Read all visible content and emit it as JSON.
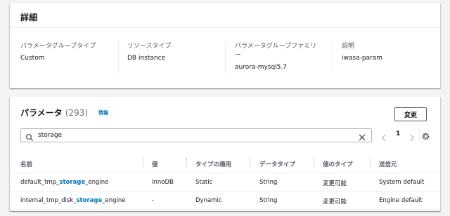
{
  "details": {
    "title": "詳細",
    "items": [
      {
        "label": "パラメータグループタイプ",
        "value": "Custom"
      },
      {
        "label": "リソースタイプ",
        "value": "DB instance"
      },
      {
        "label": "パラメータグループファミリ",
        "label_cont": "ー",
        "value": "aurora-mysql5.7"
      },
      {
        "label": "説明",
        "value": "iwasa-param"
      }
    ]
  },
  "parameters": {
    "title": "パラメータ",
    "count": "(293)",
    "info_link": "情報",
    "edit_button": "変更",
    "search": {
      "value": "storage"
    },
    "pagination": {
      "current_page": "1"
    },
    "columns": [
      "名前",
      "値",
      "タイプの適用",
      "データタイプ",
      "値のタイプ",
      "送信元"
    ],
    "rows": [
      {
        "name_pre": "default_tmp_",
        "name_hl": "storage",
        "name_post": "_engine",
        "value": "InnoDB",
        "apply_type": "Static",
        "data_type": "String",
        "value_type": "変更可能",
        "source": "System default"
      },
      {
        "name_pre": "internal_tmp_disk_",
        "name_hl": "storage",
        "name_post": "_engine",
        "value": "-",
        "apply_type": "Dynamic",
        "data_type": "String",
        "value_type": "変更可能",
        "source": "Engine default"
      }
    ]
  },
  "colors": {
    "accent": "#0073bb",
    "background": "#f2f3f3",
    "border": "#eaeded"
  },
  "icons": {
    "search": "search-icon",
    "clear": "close-icon",
    "prev": "chevron-left-icon",
    "next": "chevron-right-icon",
    "settings": "gear-icon"
  }
}
